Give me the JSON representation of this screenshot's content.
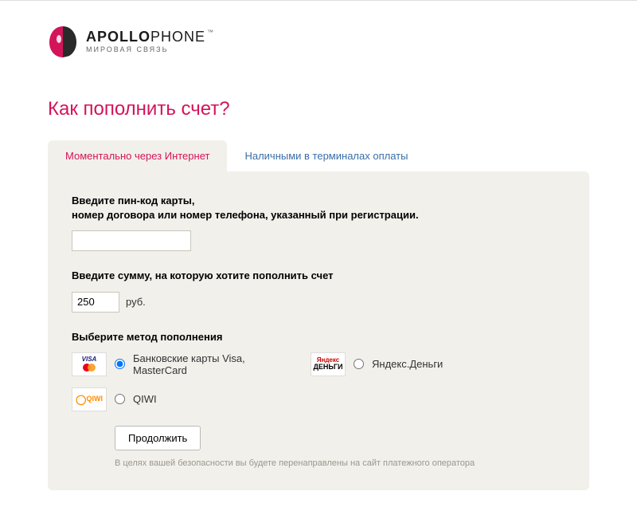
{
  "brand": {
    "name_bold": "APOLLO",
    "name_light": "PHONE",
    "tagline": "МИРОВАЯ СВЯЗЬ",
    "tm": "™"
  },
  "page_title": "Как пополнить счет?",
  "tabs": {
    "instant": "Моментально через Интернет",
    "cash": "Наличными в терминалах оплаты"
  },
  "form": {
    "pin_label_line1": "Введите пин-код карты,",
    "pin_label_line2": "номер договора или номер телефона, указанный при регистрации.",
    "pin_value": "",
    "amount_label": "Введите сумму, на которую хотите пополнить счет",
    "amount_value": "250",
    "currency": "руб.",
    "method_label": "Выберите метод пополнения",
    "methods": {
      "visa": "Банковские карты Visa, MasterCard",
      "yandex": "Яндекс.Деньги",
      "qiwi": "QIWI"
    },
    "submit": "Продолжить",
    "disclaimer": "В целях вашей безопасности вы будете перенаправлены на сайт платежного оператора"
  },
  "icons": {
    "visa_text": "VISA",
    "yandex_l1": "Яндекс",
    "yandex_l2": "ДЕНЬГИ",
    "qiwi_text": "QIWI"
  }
}
